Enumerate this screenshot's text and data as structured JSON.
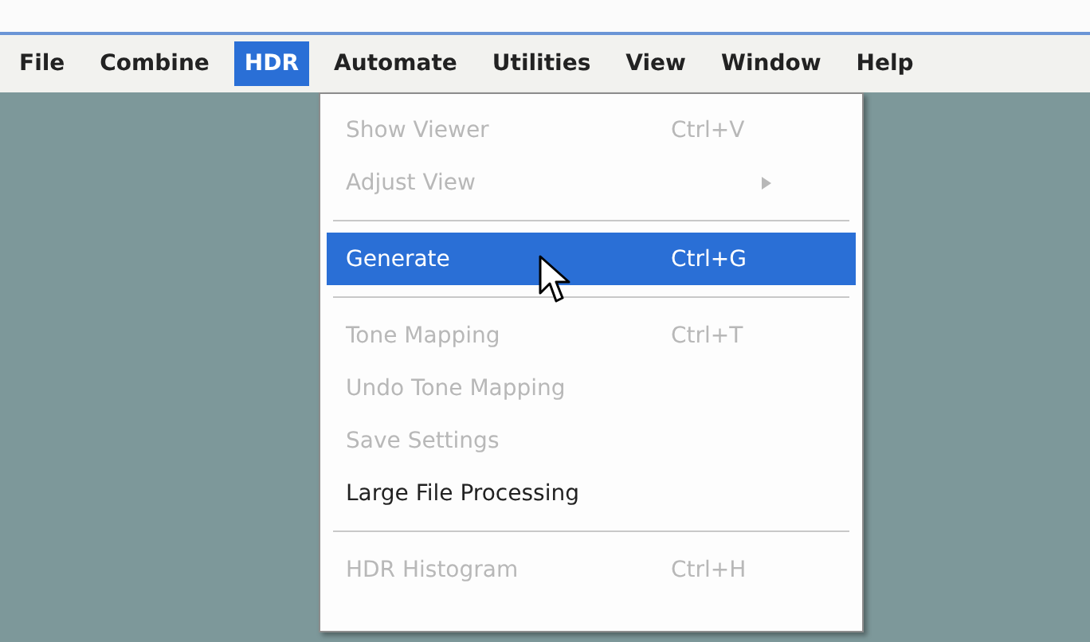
{
  "menu_bar": [
    {
      "label": "File",
      "selected": false
    },
    {
      "label": "Combine",
      "selected": false
    },
    {
      "label": "HDR",
      "selected": true
    },
    {
      "label": "Automate",
      "selected": false
    },
    {
      "label": "Utilities",
      "selected": false
    },
    {
      "label": "View",
      "selected": false
    },
    {
      "label": "Window",
      "selected": false
    },
    {
      "label": "Help",
      "selected": false
    }
  ],
  "menu": {
    "items": [
      {
        "kind": "item",
        "label": "Show Viewer",
        "shortcut": "Ctrl+V",
        "disabled": true,
        "selected": false
      },
      {
        "kind": "item",
        "label": "Adjust View",
        "submenu": true,
        "disabled": true,
        "selected": false
      },
      {
        "kind": "separator"
      },
      {
        "kind": "item",
        "label": "Generate",
        "shortcut": "Ctrl+G",
        "disabled": false,
        "selected": true
      },
      {
        "kind": "separator"
      },
      {
        "kind": "item",
        "label": "Tone Mapping",
        "shortcut": "Ctrl+T",
        "disabled": true,
        "selected": false
      },
      {
        "kind": "item",
        "label": "Undo Tone Mapping",
        "disabled": true,
        "selected": false
      },
      {
        "kind": "item",
        "label": "Save Settings",
        "disabled": true,
        "selected": false
      },
      {
        "kind": "item",
        "label": "Large File Processing",
        "disabled": false,
        "selected": false
      },
      {
        "kind": "separator"
      },
      {
        "kind": "item",
        "label": "HDR Histogram",
        "shortcut": "Ctrl+H",
        "disabled": true,
        "selected": false
      }
    ]
  }
}
